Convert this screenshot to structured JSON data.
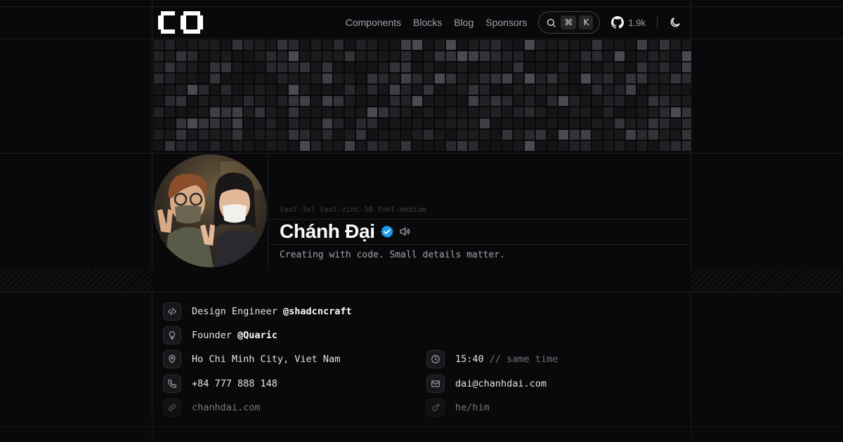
{
  "header": {
    "nav": [
      "Components",
      "Blocks",
      "Blog",
      "Sponsors"
    ],
    "search": {
      "cmd_key": "⌘",
      "k_key": "K"
    },
    "github_stars": "1.9k",
    "icons": {
      "logo": "logo-mark",
      "search": "search-icon",
      "github": "github-icon",
      "theme": "moon-icon"
    }
  },
  "profile": {
    "debug_class": "text-3xl text-zinc-50 font-medium",
    "name": "Chánh Đại",
    "tagline": "Creating with code. Small details matter.",
    "accent": "#1d9bf0"
  },
  "info": {
    "role": {
      "text": "Design Engineer ",
      "handle": "@shadcncraft",
      "icon": "code-icon"
    },
    "founder": {
      "text": "Founder ",
      "handle": "@Quaric",
      "icon": "lightbulb-icon"
    },
    "location": {
      "text": "Ho Chi Minh City, Viet Nam",
      "icon": "map-pin-icon"
    },
    "time": {
      "value": "15:40",
      "note": " // same time",
      "icon": "clock-icon"
    },
    "phone": {
      "text": "+84 777 888 148",
      "icon": "phone-icon"
    },
    "email": {
      "text": "dai@chanhdai.com",
      "icon": "mail-icon"
    },
    "website": {
      "text": "chanhdai.com",
      "icon": "link-icon"
    },
    "pronouns": {
      "text": "he/him",
      "icon": "mars-icon"
    }
  }
}
